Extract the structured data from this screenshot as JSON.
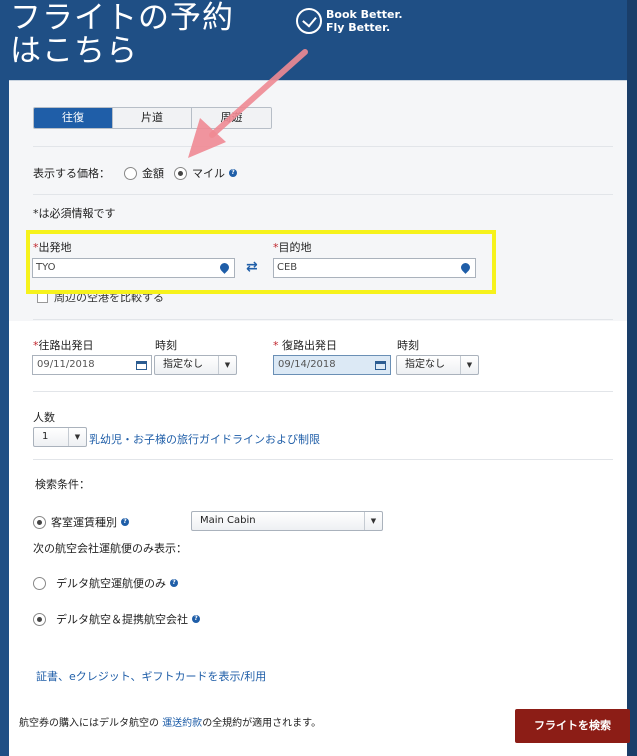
{
  "header": {
    "title": "フライトの予約\nはこちら",
    "brand_line1": "Book Better.",
    "brand_line2": "Fly Better."
  },
  "trip_type": {
    "tabs": [
      {
        "label": "往復",
        "active": true
      },
      {
        "label": "片道",
        "active": false
      },
      {
        "label": "周遊",
        "active": false
      }
    ]
  },
  "price_display": {
    "label": "表示する価格：",
    "options": [
      {
        "label": "金額",
        "checked": false
      },
      {
        "label": "マイル",
        "checked": true
      }
    ]
  },
  "required_note": "*は必須情報です",
  "origin": {
    "label": "出発地",
    "value": "TYO"
  },
  "destination": {
    "label": "目的地",
    "value": "CEB"
  },
  "nearby_airports": "周辺の空港を比較する",
  "outbound": {
    "date_label": "往路出発日",
    "date": "09/11/2018",
    "time_label": "時刻",
    "time": "指定なし"
  },
  "inbound": {
    "date_label": "復路出発日",
    "date": "09/14/2018",
    "time_label": "時刻",
    "time": "指定なし"
  },
  "passengers": {
    "label": "人数",
    "value": "1",
    "guide_link": "乳幼児・お子様の旅行ガイドラインおよび制限"
  },
  "search_conditions": {
    "label": "検索条件：",
    "cabin_label": "客室運賃種別",
    "cabin_value": "Main Cabin",
    "carrier_label": "次の航空会社運航便のみ表示：",
    "carrier_options": [
      {
        "label": "デルタ航空運航便のみ",
        "checked": false
      },
      {
        "label": "デルタ航空＆提携航空会社",
        "checked": true
      }
    ]
  },
  "certificates_link": "証書、eクレジット、ギフトカードを表示/利用",
  "footer": {
    "note_prefix": "航空券の購入にはデルタ航空の",
    "note_link": "運送約款",
    "note_suffix": "の全規約が適用されます。",
    "search_button": "フライトを検索"
  },
  "colors": {
    "header_bg": "#1f4f85",
    "accent": "#1f5ea8",
    "button": "#8c1d16",
    "highlight": "#f6f21c",
    "annotation_arrow": "#ef8a94"
  }
}
